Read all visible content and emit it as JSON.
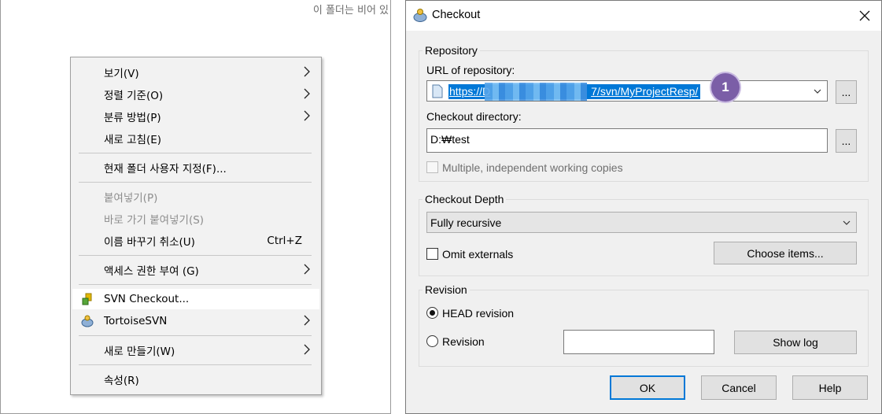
{
  "explorer": {
    "empty_message": "이 폴더는 비어 있",
    "context_menu": {
      "items": [
        {
          "label": "보기(V)",
          "submenu": true
        },
        {
          "label": "정렬 기준(O)",
          "submenu": true
        },
        {
          "label": "분류 방법(P)",
          "submenu": true
        },
        {
          "label": "새로 고침(E)",
          "submenu": false
        },
        {
          "label": "현재 폴더 사용자 지정(F)...",
          "submenu": false
        },
        {
          "label": "붙여넣기(P)",
          "disabled": true
        },
        {
          "label": "바로 가기 붙여넣기(S)",
          "disabled": true
        },
        {
          "label": "이름 바꾸기 취소(U)",
          "shortcut": "Ctrl+Z"
        },
        {
          "label": "액세스 권한 부여 (G)",
          "submenu": true
        },
        {
          "label": "SVN Checkout...",
          "highlighted": true,
          "icon": "svn-checkout-icon"
        },
        {
          "label": "TortoiseSVN",
          "submenu": true,
          "icon": "tortoisesvn-icon"
        },
        {
          "label": "새로 만들기(W)",
          "submenu": true
        },
        {
          "label": "속성(R)",
          "submenu": false
        }
      ]
    }
  },
  "dialog": {
    "title": "Checkout",
    "repository": {
      "group_label": "Repository",
      "url_label": "URL of repository:",
      "url_prefix": "https://D",
      "url_suffix": "7/svn/MyProjectResp/",
      "browse_label": "...",
      "dir_label": "Checkout directory:",
      "dir_value": "D:₩test",
      "dir_browse_label": "...",
      "multiple_label": "Multiple, independent working copies"
    },
    "depth": {
      "group_label": "Checkout Depth",
      "selected": "Fully recursive",
      "omit_label": "Omit externals",
      "choose_label": "Choose items..."
    },
    "revision": {
      "group_label": "Revision",
      "head_label": "HEAD revision",
      "rev_label": "Revision",
      "rev_value": "",
      "show_log_label": "Show log"
    },
    "buttons": {
      "ok": "OK",
      "cancel": "Cancel",
      "help": "Help"
    },
    "annotation_badge": "1"
  },
  "colors": {
    "accent": "#0078d7",
    "badge": "#7b5ea7"
  }
}
